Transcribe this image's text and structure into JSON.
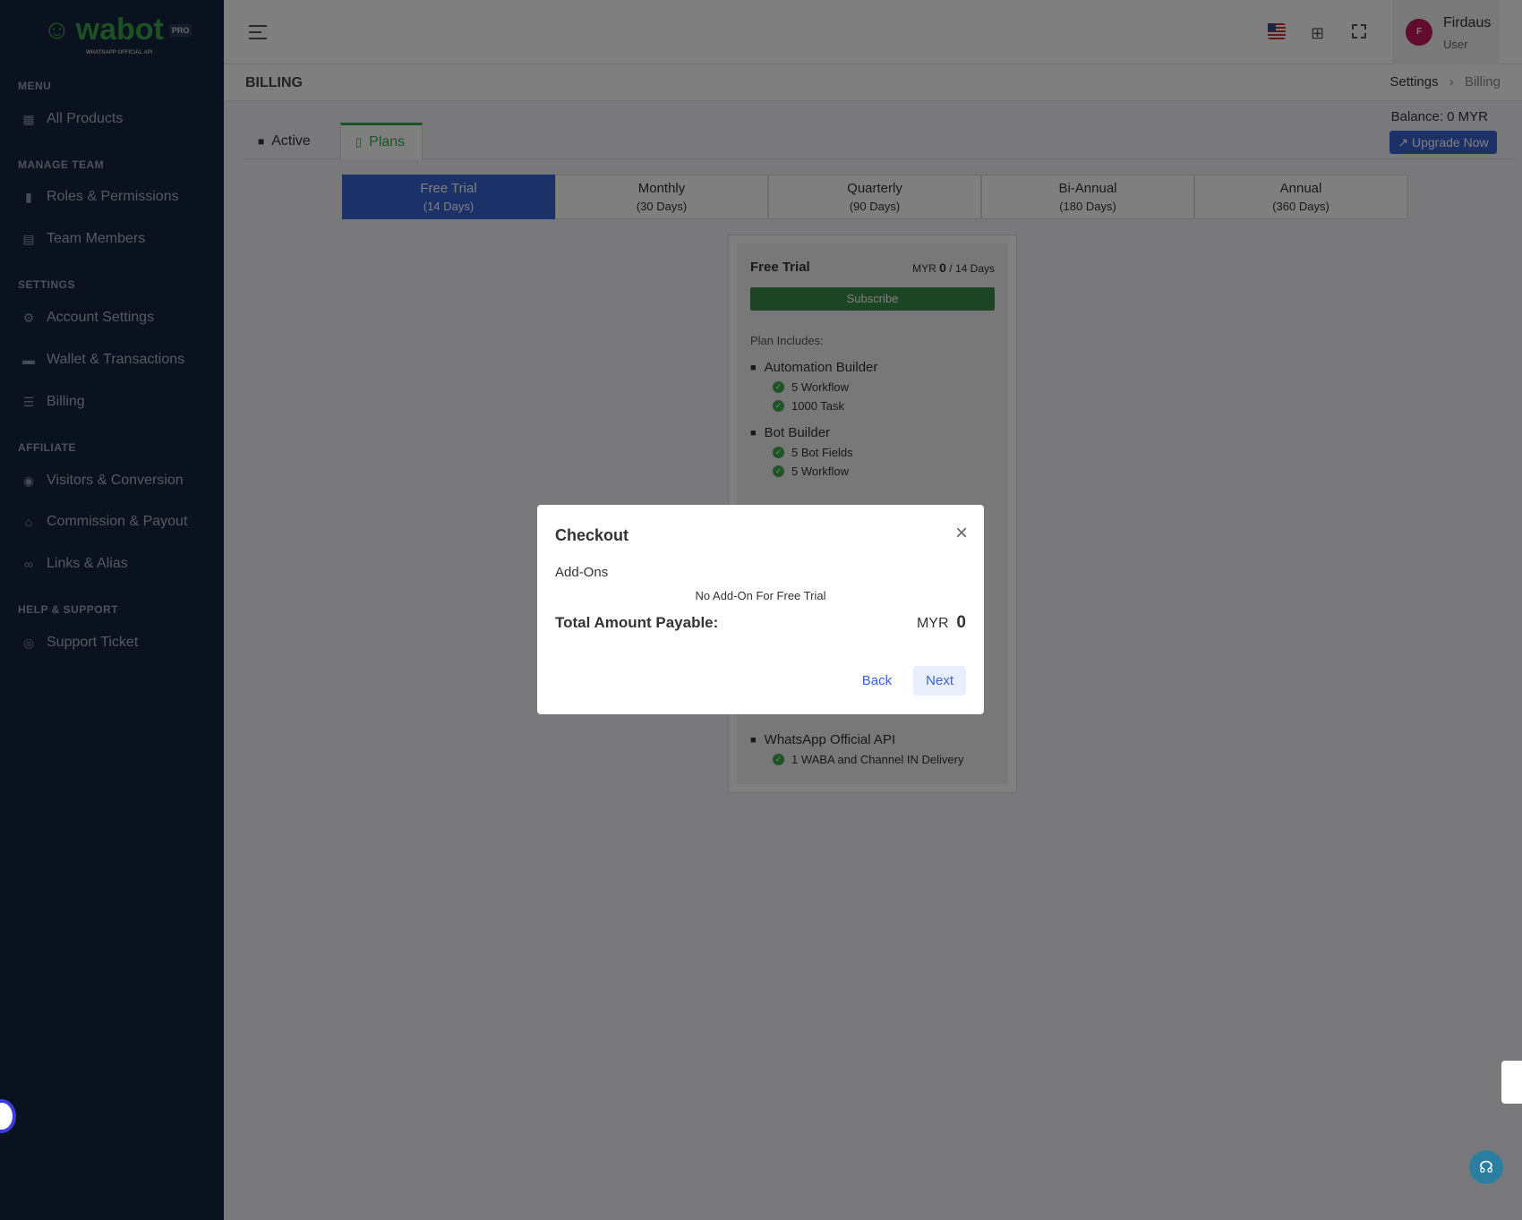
{
  "brand": {
    "name": "wabot",
    "badge": "PRO",
    "tagline": "WHATSAPP OFFICIAL API"
  },
  "sidebar": {
    "sections": [
      {
        "title": "MENU",
        "items": [
          {
            "label": "All Products",
            "icon": "grid-icon"
          }
        ]
      },
      {
        "title": "MANAGE TEAM",
        "items": [
          {
            "label": "Roles & Permissions",
            "icon": "badge-icon"
          },
          {
            "label": "Team Members",
            "icon": "contacts-icon"
          }
        ]
      },
      {
        "title": "SETTINGS",
        "items": [
          {
            "label": "Account Settings",
            "icon": "gear-icon"
          },
          {
            "label": "Wallet & Transactions",
            "icon": "wallet-icon"
          },
          {
            "label": "Billing",
            "icon": "card-icon"
          }
        ]
      },
      {
        "title": "AFFILIATE",
        "items": [
          {
            "label": "Visitors & Conversion",
            "icon": "eye-icon"
          },
          {
            "label": "Commission & Payout",
            "icon": "bank-icon"
          },
          {
            "label": "Links & Alias",
            "icon": "link-icon"
          }
        ]
      },
      {
        "title": "HELP & SUPPORT",
        "items": [
          {
            "label": "Support Ticket",
            "icon": "lifebuoy-icon"
          }
        ]
      }
    ]
  },
  "header": {
    "user_name": "Firdaus",
    "user_role": "User",
    "avatar_initial": "F"
  },
  "page": {
    "title": "BILLING",
    "breadcrumb": [
      "Settings",
      "Billing"
    ],
    "balance": "Balance: 0 MYR",
    "upgrade_label": "Upgrade Now"
  },
  "tabs": [
    {
      "label": "Active"
    },
    {
      "label": "Plans",
      "active": true
    }
  ],
  "plan_tabs": [
    {
      "name": "Free Trial",
      "days": "(14 Days)",
      "active": true
    },
    {
      "name": "Monthly",
      "days": "(30 Days)"
    },
    {
      "name": "Quarterly",
      "days": "(90 Days)"
    },
    {
      "name": "Bi-Annual",
      "days": "(180 Days)"
    },
    {
      "name": "Annual",
      "days": "(360 Days)"
    }
  ],
  "plan": {
    "name": "Free Trial",
    "currency": "MYR",
    "price": "0",
    "period": "/ 14 Days",
    "subscribe_label": "Subscribe",
    "includes_label": "Plan Includes:",
    "features": [
      {
        "name": "Automation Builder",
        "items": [
          "5 Workflow",
          "1000 Task"
        ]
      },
      {
        "name": "Bot Builder",
        "items": [
          "5 Bot Fields",
          "5 Workflow"
        ]
      }
    ],
    "last_feature": {
      "name": "WhatsApp Official API",
      "items": [
        "1 WABA and Channel IN Delivery"
      ]
    }
  },
  "modal": {
    "title": "Checkout",
    "addons_label": "Add-Ons",
    "no_addon": "No Add-On For Free Trial",
    "total_label": "Total Amount Payable:",
    "currency": "MYR",
    "total": "0",
    "back_label": "Back",
    "next_label": "Next"
  },
  "colors": {
    "accent": "#3b63d3",
    "success": "#3fa651",
    "sidebar": "#17253f"
  }
}
